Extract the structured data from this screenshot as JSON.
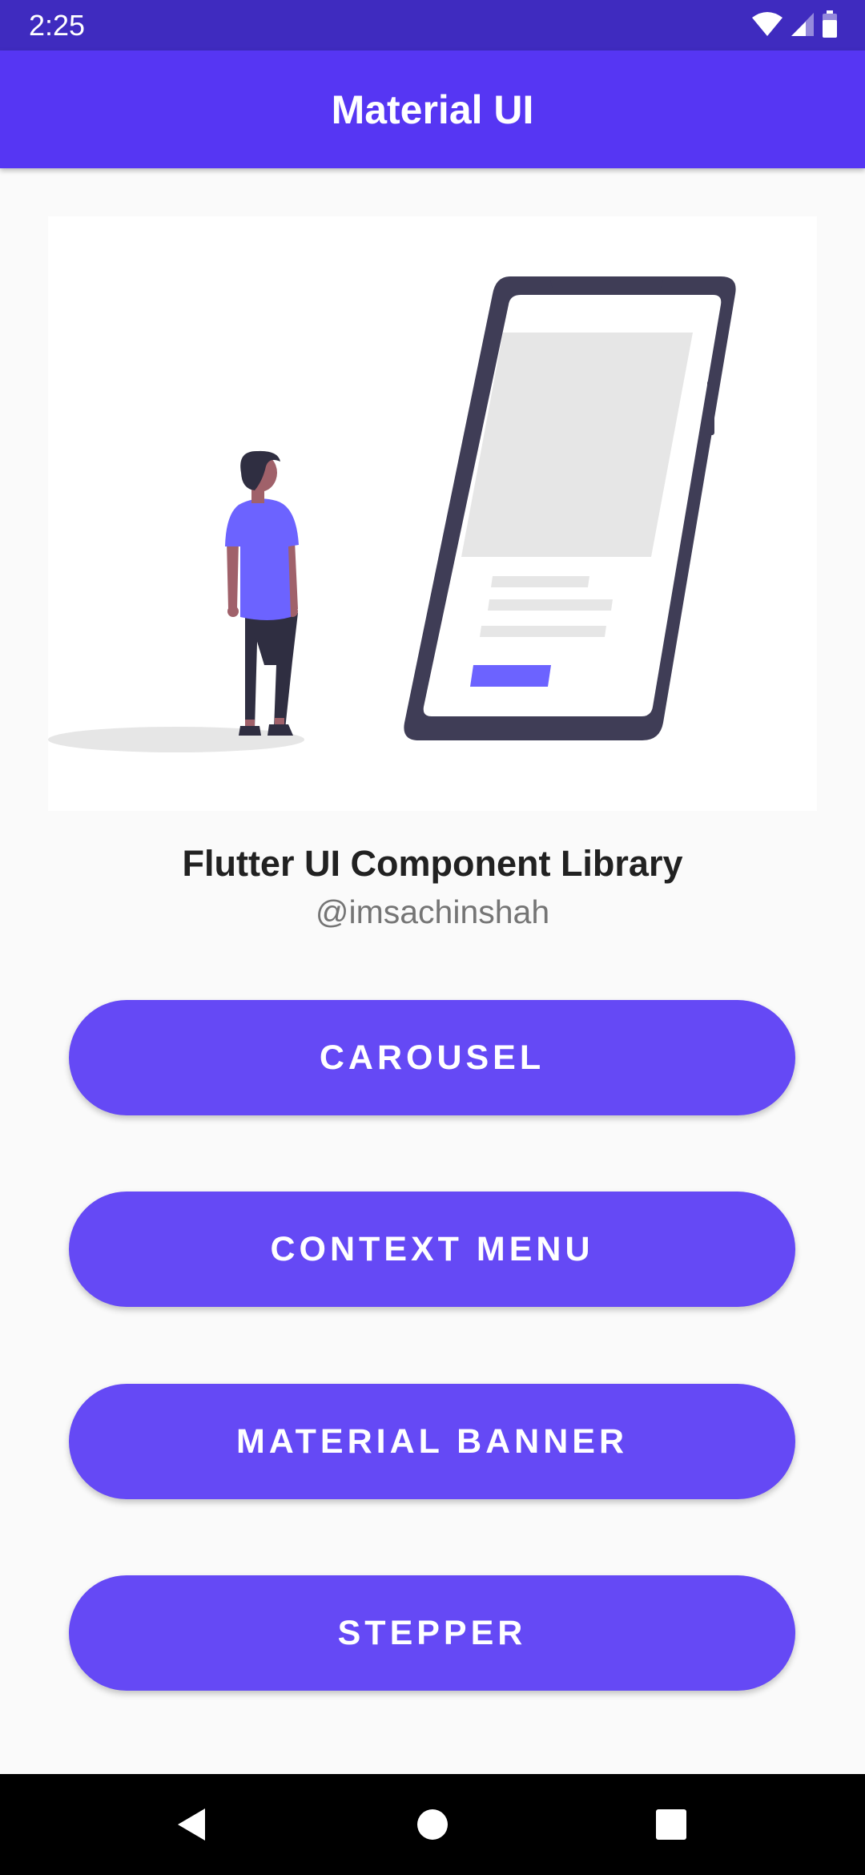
{
  "status_bar": {
    "time": "2:25",
    "icons": [
      "wifi-icon",
      "cellular-signal-icon",
      "battery-icon"
    ]
  },
  "app_bar": {
    "title": "Material UI"
  },
  "hero": {
    "illustration": "person-looking-at-phone-illustration"
  },
  "library": {
    "title": "Flutter UI Component Library",
    "handle": "@imsachinshah"
  },
  "buttons": [
    {
      "label": "CAROUSEL"
    },
    {
      "label": "CONTEXT MENU"
    },
    {
      "label": "MATERIAL BANNER"
    },
    {
      "label": "STEPPER"
    }
  ],
  "nav_bar": {
    "icons": [
      "back-icon",
      "home-icon",
      "recents-icon"
    ]
  },
  "colors": {
    "status_bar": "#3f2bbf",
    "app_bar": "#5636f3",
    "button": "#6549f5",
    "background": "#fafafa"
  }
}
